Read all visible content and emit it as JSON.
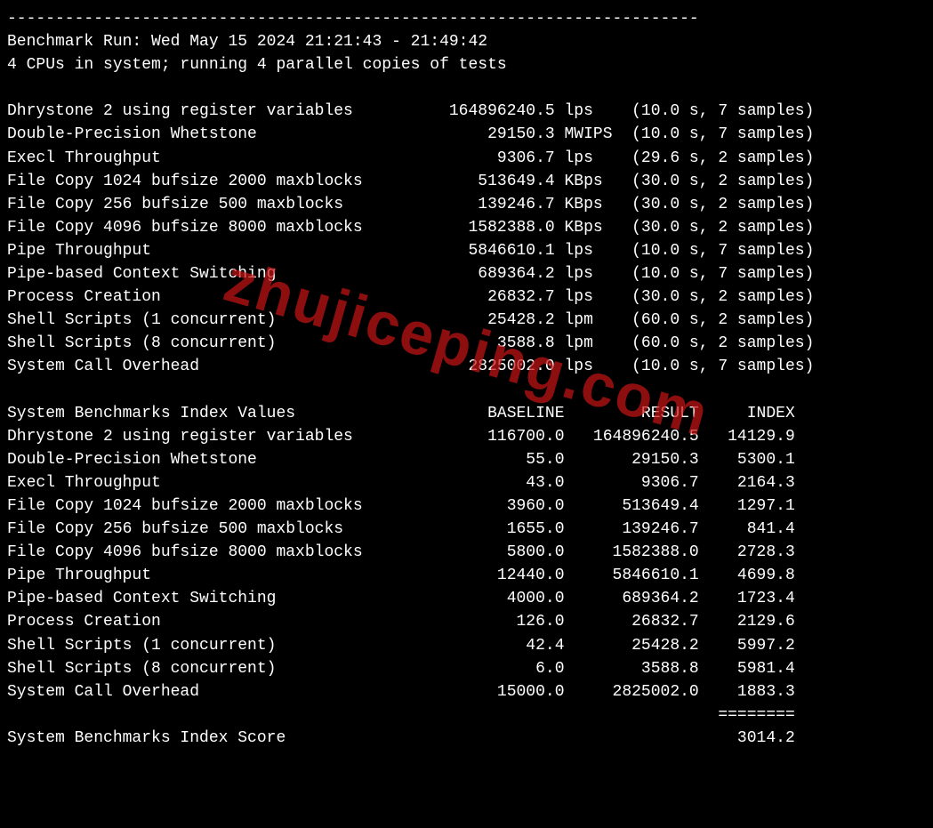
{
  "dashes": "------------------------------------------------------------------------",
  "run_header": "Benchmark Run: Wed May 15 2024 21:21:43 - 21:49:42",
  "cpu_header": "4 CPUs in system; running 4 parallel copies of tests",
  "watermark": "zhujiceping.com",
  "tests": [
    {
      "name": "Dhrystone 2 using register variables",
      "value": "164896240.5",
      "unit": "lps",
      "time": "10.0",
      "samples": "7"
    },
    {
      "name": "Double-Precision Whetstone",
      "value": "29150.3",
      "unit": "MWIPS",
      "time": "10.0",
      "samples": "7"
    },
    {
      "name": "Execl Throughput",
      "value": "9306.7",
      "unit": "lps",
      "time": "29.6",
      "samples": "2"
    },
    {
      "name": "File Copy 1024 bufsize 2000 maxblocks",
      "value": "513649.4",
      "unit": "KBps",
      "time": "30.0",
      "samples": "2"
    },
    {
      "name": "File Copy 256 bufsize 500 maxblocks",
      "value": "139246.7",
      "unit": "KBps",
      "time": "30.0",
      "samples": "2"
    },
    {
      "name": "File Copy 4096 bufsize 8000 maxblocks",
      "value": "1582388.0",
      "unit": "KBps",
      "time": "30.0",
      "samples": "2"
    },
    {
      "name": "Pipe Throughput",
      "value": "5846610.1",
      "unit": "lps",
      "time": "10.0",
      "samples": "7"
    },
    {
      "name": "Pipe-based Context Switching",
      "value": "689364.2",
      "unit": "lps",
      "time": "10.0",
      "samples": "7"
    },
    {
      "name": "Process Creation",
      "value": "26832.7",
      "unit": "lps",
      "time": "30.0",
      "samples": "2"
    },
    {
      "name": "Shell Scripts (1 concurrent)",
      "value": "25428.2",
      "unit": "lpm",
      "time": "60.0",
      "samples": "2"
    },
    {
      "name": "Shell Scripts (8 concurrent)",
      "value": "3588.8",
      "unit": "lpm",
      "time": "60.0",
      "samples": "2"
    },
    {
      "name": "System Call Overhead",
      "value": "2825002.0",
      "unit": "lps",
      "time": "10.0",
      "samples": "7"
    }
  ],
  "index_header": {
    "title": "System Benchmarks Index Values",
    "col_baseline": "BASELINE",
    "col_result": "RESULT",
    "col_index": "INDEX"
  },
  "index_rows": [
    {
      "name": "Dhrystone 2 using register variables",
      "baseline": "116700.0",
      "result": "164896240.5",
      "index": "14129.9"
    },
    {
      "name": "Double-Precision Whetstone",
      "baseline": "55.0",
      "result": "29150.3",
      "index": "5300.1"
    },
    {
      "name": "Execl Throughput",
      "baseline": "43.0",
      "result": "9306.7",
      "index": "2164.3"
    },
    {
      "name": "File Copy 1024 bufsize 2000 maxblocks",
      "baseline": "3960.0",
      "result": "513649.4",
      "index": "1297.1"
    },
    {
      "name": "File Copy 256 bufsize 500 maxblocks",
      "baseline": "1655.0",
      "result": "139246.7",
      "index": "841.4"
    },
    {
      "name": "File Copy 4096 bufsize 8000 maxblocks",
      "baseline": "5800.0",
      "result": "1582388.0",
      "index": "2728.3"
    },
    {
      "name": "Pipe Throughput",
      "baseline": "12440.0",
      "result": "5846610.1",
      "index": "4699.8"
    },
    {
      "name": "Pipe-based Context Switching",
      "baseline": "4000.0",
      "result": "689364.2",
      "index": "1723.4"
    },
    {
      "name": "Process Creation",
      "baseline": "126.0",
      "result": "26832.7",
      "index": "2129.6"
    },
    {
      "name": "Shell Scripts (1 concurrent)",
      "baseline": "42.4",
      "result": "25428.2",
      "index": "5997.2"
    },
    {
      "name": "Shell Scripts (8 concurrent)",
      "baseline": "6.0",
      "result": "3588.8",
      "index": "5981.4"
    },
    {
      "name": "System Call Overhead",
      "baseline": "15000.0",
      "result": "2825002.0",
      "index": "1883.3"
    }
  ],
  "divider": "========",
  "score_label": "System Benchmarks Index Score",
  "score_value": "3014.2"
}
